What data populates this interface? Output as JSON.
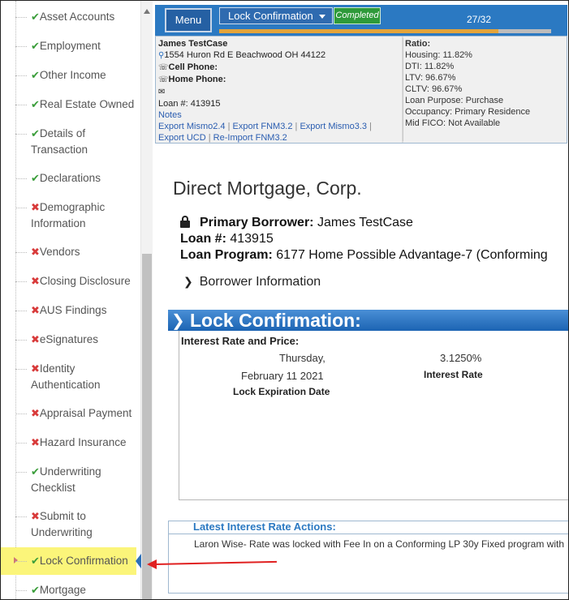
{
  "sidebar": {
    "items": [
      {
        "status": "done",
        "label": "Asset Accounts"
      },
      {
        "status": "done",
        "label": "Employment"
      },
      {
        "status": "done",
        "label": "Other Income"
      },
      {
        "status": "done",
        "label": "Real Estate Owned"
      },
      {
        "status": "done",
        "label": "Details of Transaction"
      },
      {
        "status": "done",
        "label": "Declarations"
      },
      {
        "status": "error",
        "label": "Demographic Information"
      },
      {
        "status": "error",
        "label": "Vendors"
      },
      {
        "status": "error",
        "label": "Closing Disclosure"
      },
      {
        "status": "error",
        "label": "AUS Findings"
      },
      {
        "status": "error",
        "label": "eSignatures"
      },
      {
        "status": "error",
        "label": "Identity Authentication"
      },
      {
        "status": "error",
        "label": "Appraisal Payment"
      },
      {
        "status": "error",
        "label": "Hazard Insurance"
      },
      {
        "status": "done",
        "label": "Underwriting Checklist"
      },
      {
        "status": "error",
        "label": "Submit to Underwriting"
      },
      {
        "status": "done",
        "label": "Lock Confirmation",
        "active": true
      },
      {
        "status": "done",
        "label": "Mortgage"
      }
    ],
    "check_glyph": "✔",
    "x_glyph": "✖"
  },
  "topbar": {
    "menu_label": "Menu",
    "page_select_value": "Lock Confirmation",
    "status_badge": "Completed",
    "progress_text": "27/32",
    "progress_fraction": 0.84
  },
  "borrower_panel": {
    "name": "James TestCase",
    "address": "1554 Huron Rd E Beachwood OH 44122",
    "cell_phone_label": "Cell Phone:",
    "home_phone_label": "Home Phone:",
    "loan_number_line": "Loan #: 413915",
    "notes_link": "Notes",
    "links": {
      "export_mismo24": "Export Mismo2.4",
      "export_fnm32": "Export FNM3.2",
      "export_mismo33": "Export Mismo3.3",
      "export_ucd": "Export UCD",
      "reimport_fnm32": "Re-Import FNM3.2"
    }
  },
  "ratios": {
    "title": "Ratio:",
    "housing": "Housing: 11.82%",
    "dti": "DTI: 11.82%",
    "ltv": "LTV: 96.67%",
    "cltv": "CLTV: 96.67%",
    "loan_purpose": "Loan Purpose: Purchase",
    "occupancy": "Occupancy: Primary Residence",
    "mid_fico": "Mid FICO: Not Available"
  },
  "main": {
    "company": "Direct Mortgage, Corp.",
    "primary_borrower_label": "Primary Borrower:",
    "primary_borrower_value": "James TestCase",
    "loan_number_label": "Loan #:",
    "loan_number_value": "413915",
    "loan_program_label": "Loan Program:",
    "loan_program_value": "6177 Home Possible Advantage-7 (Conforming",
    "borrower_info_toggle": "Borrower Information",
    "section_title": "Lock Confirmation:",
    "interest_heading": "Interest Rate and Price:",
    "lock_date_day": "Thursday,",
    "lock_date": "February 11 2021",
    "lock_expiration_label": "Lock Expiration Date",
    "interest_rate_value": "3.1250%",
    "interest_rate_label": "Interest Rate",
    "actions_title": "Latest Interest Rate Actions:",
    "actions_text": "Laron Wise- Rate was locked with Fee In on a Conforming LP 30y Fixed program with a"
  },
  "colors": {
    "accent": "#2b79c2",
    "active_highlight": "#fbf57a",
    "completed_badge": "#2e9a3a",
    "check": "#3a9d3a",
    "error": "#d83a3a",
    "annotation_arrow": "#e02020"
  }
}
